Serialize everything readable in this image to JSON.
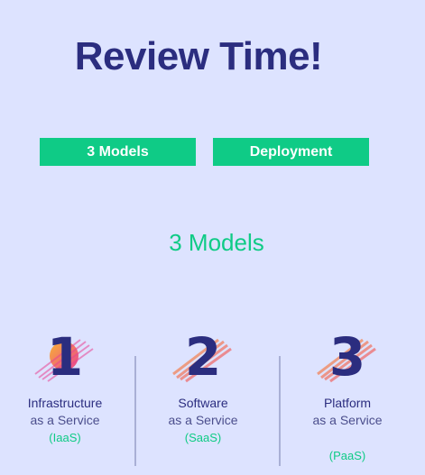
{
  "title": "Review Time!",
  "tabs": [
    {
      "label": "3 Models"
    },
    {
      "label": "Deployment"
    }
  ],
  "section_heading": "3 Models",
  "models": [
    {
      "number": "1",
      "name": "Infrastructure",
      "subtitle": "as a Service",
      "abbr": "(IaaS)"
    },
    {
      "number": "2",
      "name": "Software",
      "subtitle": "as a Service",
      "abbr": "(SaaS)"
    },
    {
      "number": "3",
      "name": "Platform",
      "subtitle": "as a Service",
      "abbr": "(PaaS)"
    }
  ],
  "colors": {
    "background": "#dde3ff",
    "primary_text": "#2b2d7f",
    "accent_green": "#0fcb86",
    "brush_gradient_start": "#f9b233",
    "brush_gradient_end": "#e84393"
  }
}
